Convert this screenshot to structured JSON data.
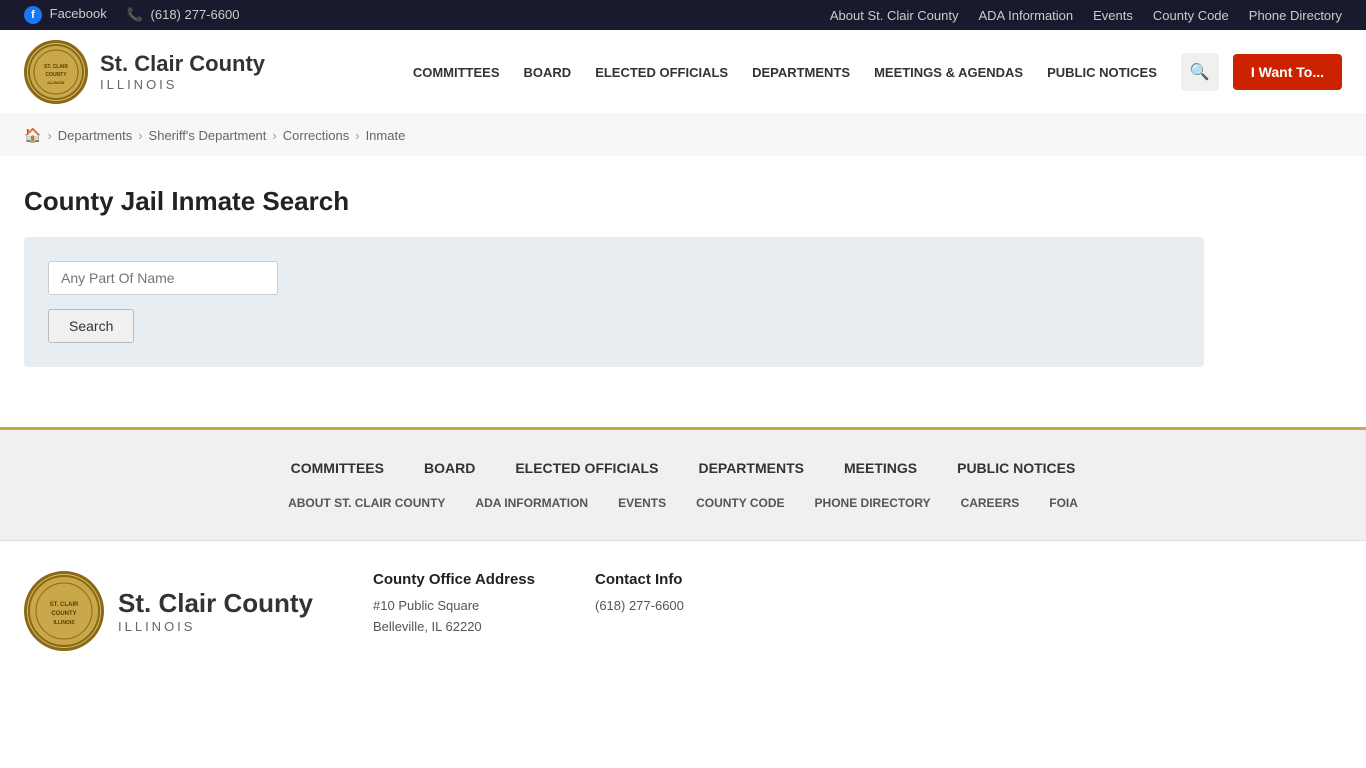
{
  "topbar": {
    "facebook_label": "Facebook",
    "phone_label": "(618) 277-6600",
    "links": [
      {
        "id": "about",
        "label": "About St. Clair County"
      },
      {
        "id": "ada",
        "label": "ADA Information"
      },
      {
        "id": "events",
        "label": "Events"
      },
      {
        "id": "county-code",
        "label": "County Code"
      },
      {
        "id": "phone-dir",
        "label": "Phone Directory"
      }
    ]
  },
  "header": {
    "logo": {
      "county_name": "St. Clair County",
      "state": "ILLINOIS"
    },
    "nav": [
      {
        "id": "committees",
        "label": "COMMITTEES"
      },
      {
        "id": "board",
        "label": "BOARD"
      },
      {
        "id": "elected",
        "label": "ELECTED OFFICIALS"
      },
      {
        "id": "departments",
        "label": "DEPARTMENTS"
      },
      {
        "id": "meetings",
        "label": "MEETINGS & AGENDAS"
      },
      {
        "id": "notices",
        "label": "PUBLIC NOTICES"
      }
    ],
    "iwantto_label": "I Want To..."
  },
  "breadcrumb": {
    "items": [
      {
        "id": "home",
        "label": "Home",
        "icon": true
      },
      {
        "id": "departments",
        "label": "Departments"
      },
      {
        "id": "sheriff",
        "label": "Sheriff's Department"
      },
      {
        "id": "corrections",
        "label": "Corrections"
      },
      {
        "id": "inmate",
        "label": "Inmate",
        "current": true
      }
    ]
  },
  "main": {
    "title": "County Jail Inmate Search",
    "search": {
      "input_placeholder": "Any Part Of Name",
      "button_label": "Search"
    }
  },
  "footer_nav": {
    "primary": [
      {
        "id": "committees",
        "label": "COMMITTEES"
      },
      {
        "id": "board",
        "label": "BOARD"
      },
      {
        "id": "elected",
        "label": "ELECTED OFFICIALS"
      },
      {
        "id": "departments",
        "label": "DEPARTMENTS"
      },
      {
        "id": "meetings",
        "label": "MEETINGS"
      },
      {
        "id": "notices",
        "label": "PUBLIC NOTICES"
      }
    ],
    "secondary": [
      {
        "id": "about",
        "label": "ABOUT ST. CLAIR COUNTY"
      },
      {
        "id": "ada",
        "label": "ADA INFORMATION"
      },
      {
        "id": "events",
        "label": "EVENTS"
      },
      {
        "id": "county-code",
        "label": "COUNTY CODE"
      },
      {
        "id": "phone-dir",
        "label": "PHONE DIRECTORY"
      },
      {
        "id": "careers",
        "label": "CAREERS"
      },
      {
        "id": "foia",
        "label": "FOIA"
      }
    ]
  },
  "footer_bottom": {
    "logo": {
      "county_name": "St. Clair County",
      "state": "ILLINOIS"
    },
    "address": {
      "title": "County Office Address",
      "line1": "#10 Public Square",
      "line2": "Belleville, IL 62220"
    },
    "contact": {
      "title": "Contact Info",
      "phone": "(618) 277-6600"
    }
  }
}
